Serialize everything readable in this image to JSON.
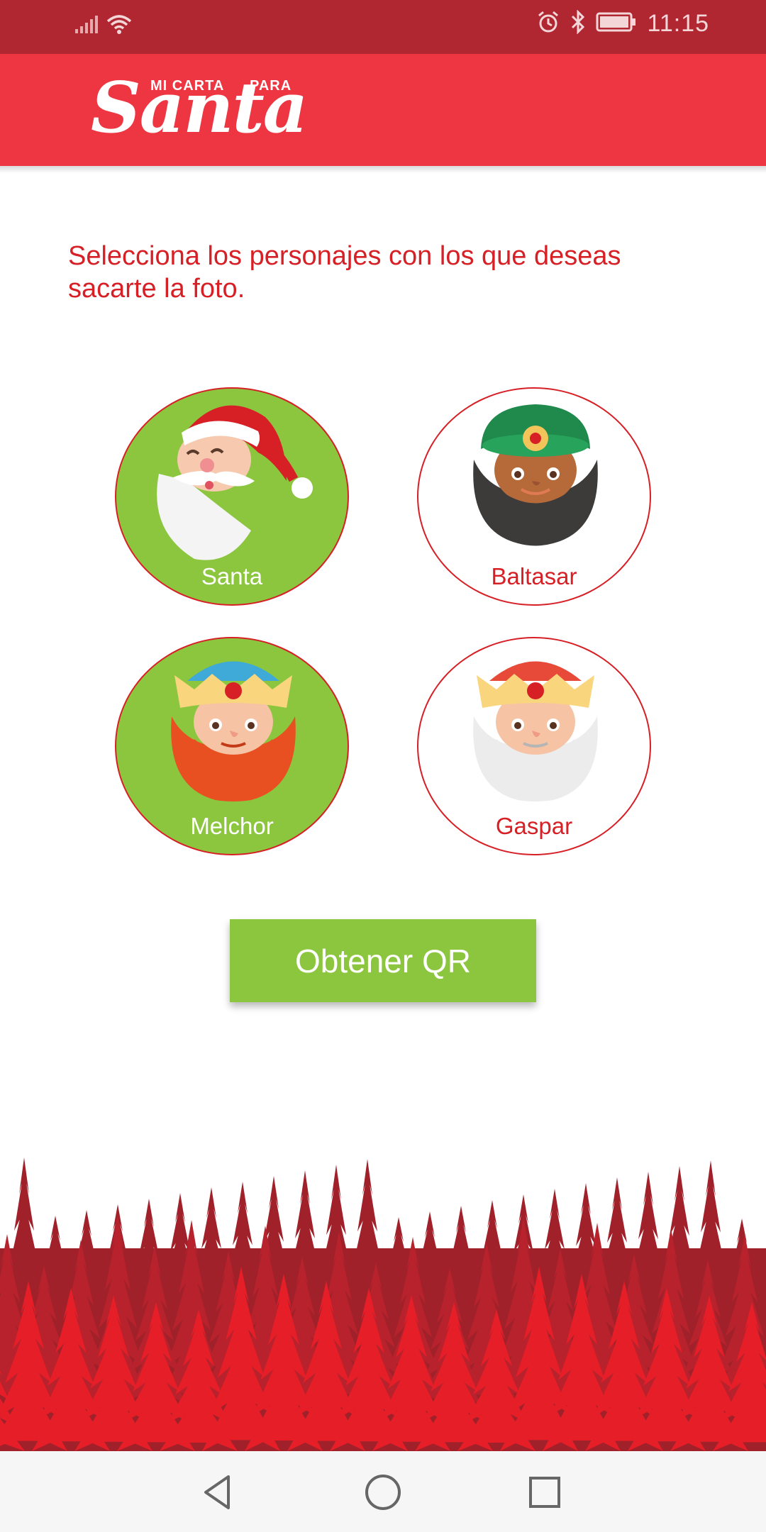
{
  "status_bar": {
    "time": "11:15",
    "icons": [
      "signal-icon",
      "wifi-icon",
      "alarm-icon",
      "bluetooth-icon",
      "battery-icon"
    ]
  },
  "app_bar": {
    "logo": {
      "small_left": "MI CARTA",
      "small_right": "PARA",
      "main": "Santa"
    },
    "background_color": "#ee3542"
  },
  "instruction": "Selecciona los personajes con los que deseas sacarte la foto.",
  "characters": [
    {
      "id": "santa",
      "label": "Santa",
      "selected": true
    },
    {
      "id": "baltasar",
      "label": "Baltasar",
      "selected": false
    },
    {
      "id": "melchor",
      "label": "Melchor",
      "selected": true
    },
    {
      "id": "gaspar",
      "label": "Gaspar",
      "selected": false
    }
  ],
  "button": {
    "label": "Obtener QR"
  },
  "colors": {
    "accent_red": "#d71f26",
    "selected_green": "#8cc63f",
    "status_bar": "#b02631"
  },
  "nav_bar": {
    "icons": [
      "back-icon",
      "home-icon",
      "recent-apps-icon"
    ]
  }
}
